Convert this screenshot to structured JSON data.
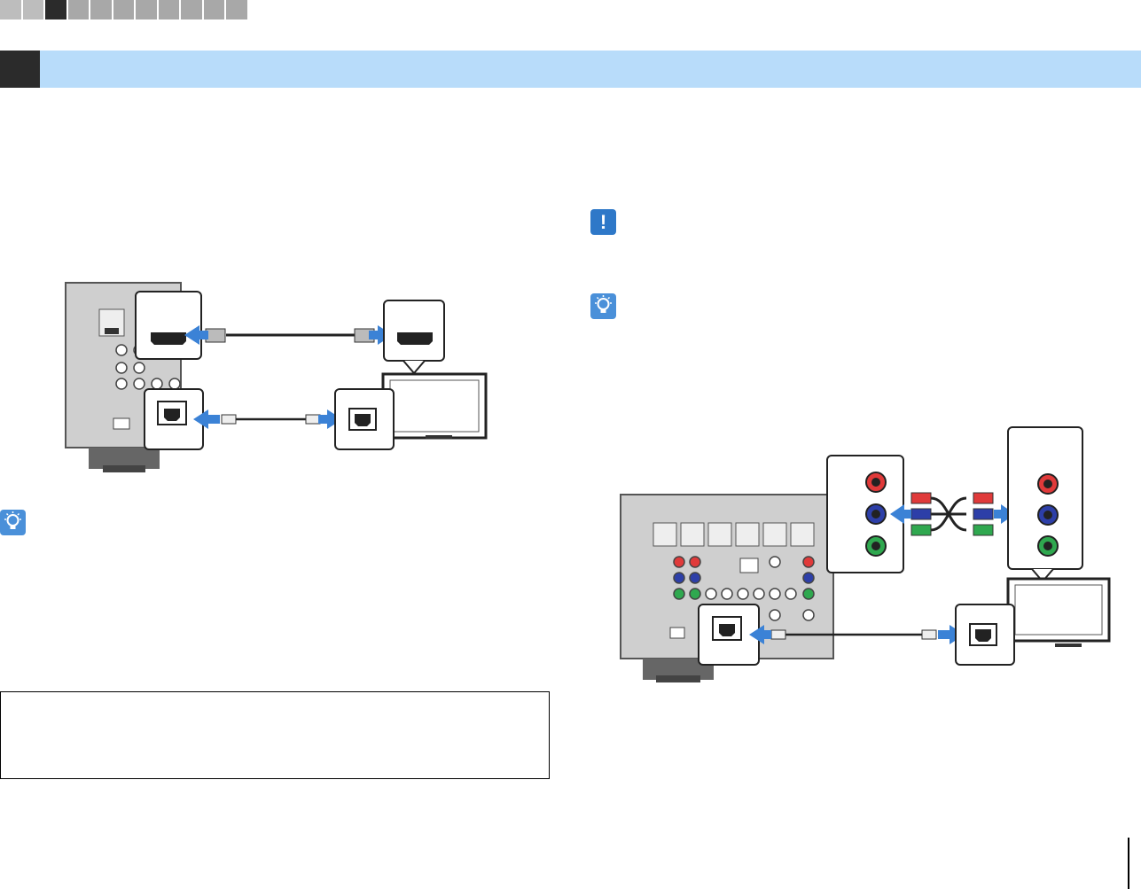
{
  "nav": {
    "segments": 11,
    "active_index": 2
  },
  "section": {
    "title": ""
  },
  "colors": {
    "section_bar": "#b8dcfa",
    "arrow_blue": "#3b82d6",
    "icon_blue": "#4a90d9",
    "component_red": "#e03a3a",
    "component_blue": "#2d3fa8",
    "component_green": "#2fa84f"
  },
  "icons": {
    "caution": "exclamation-icon",
    "hint": "lightbulb-icon",
    "caution_symbol": "!"
  },
  "diagrams": {
    "left": [
      "hdmi-cable-connection",
      "optical-cable-connection"
    ],
    "right": [
      "component-video-cable-connection",
      "optical-cable-connection"
    ]
  },
  "info_box": {
    "text": ""
  },
  "page_number": ""
}
